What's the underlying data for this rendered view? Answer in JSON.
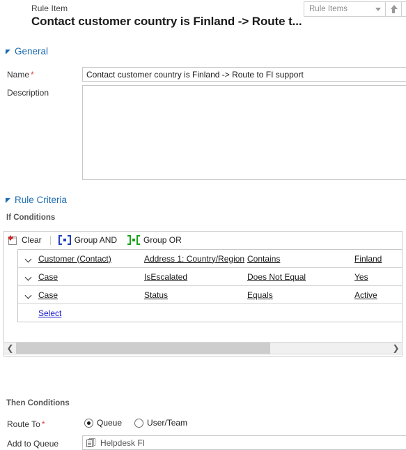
{
  "header": {
    "entity_label": "Rule Item",
    "record_title": "Contact customer country is Finland -> Route t...",
    "recordset_label": "Rule Items",
    "nav_up_icon": "arrow-up-icon",
    "nav_down_icon": "arrow-down-icon",
    "dropdown_icon": "chevron-down-icon"
  },
  "general": {
    "section_label": "General",
    "name_label": "Name",
    "name_required": "*",
    "name_value": "Contact customer country is Finland -> Route to FI support",
    "description_label": "Description",
    "description_value": ""
  },
  "rule_criteria": {
    "section_label": "Rule Criteria",
    "if_conditions_label": "If Conditions",
    "toolbar": {
      "clear_label": "Clear",
      "clear_icon": "clear-icon",
      "group_and_label": "Group AND",
      "group_and_icon": "group-and-icon",
      "group_or_label": "Group OR",
      "group_or_icon": "group-or-icon"
    },
    "rows": [
      {
        "expander_icon": "chevron-down-icon",
        "entity": "Customer (Contact)",
        "field": "Address 1: Country/Region",
        "operator": "Contains",
        "value": "Finland"
      },
      {
        "expander_icon": "chevron-down-icon",
        "entity": "Case",
        "field": "IsEscalated",
        "operator": "Does Not Equal",
        "value": "Yes"
      },
      {
        "expander_icon": "chevron-down-icon",
        "entity": "Case",
        "field": "Status",
        "operator": "Equals",
        "value": "Active"
      }
    ],
    "select_row_label": "Select",
    "scrollbar": {
      "left_arrow_icon": "chevron-left-icon",
      "right_arrow_icon": "chevron-right-icon"
    }
  },
  "then_conditions": {
    "section_label": "Then Conditions",
    "route_to_label": "Route To",
    "route_to_required": "*",
    "options": [
      {
        "label": "Queue",
        "selected": true
      },
      {
        "label": "User/Team",
        "selected": false
      }
    ],
    "add_to_queue_label": "Add to Queue",
    "add_to_queue_value": "Helpdesk FI",
    "add_to_queue_icon": "queue-icon"
  },
  "colors": {
    "section_accent": "#1c6bb0",
    "required_asterisk": "#d43f3a",
    "link_dark": "#1a1a1a",
    "link_blue": "#1414cc",
    "group_and": "#1f3fbf",
    "group_or": "#16a319"
  }
}
